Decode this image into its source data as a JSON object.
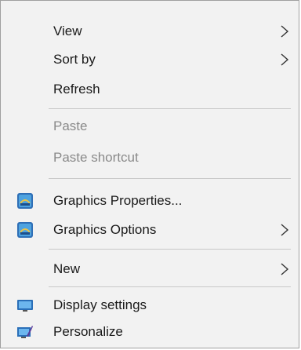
{
  "context_menu": {
    "items": [
      {
        "label": "View",
        "has_submenu": true,
        "enabled": true
      },
      {
        "label": "Sort by",
        "has_submenu": true,
        "enabled": true
      },
      {
        "label": "Refresh",
        "has_submenu": false,
        "enabled": true
      },
      {
        "label": "Paste",
        "has_submenu": false,
        "enabled": false
      },
      {
        "label": "Paste shortcut",
        "has_submenu": false,
        "enabled": false
      },
      {
        "label": "Graphics Properties...",
        "has_submenu": false,
        "enabled": true,
        "icon": "intel-graphics-icon"
      },
      {
        "label": "Graphics Options",
        "has_submenu": true,
        "enabled": true,
        "icon": "intel-graphics-icon"
      },
      {
        "label": "New",
        "has_submenu": true,
        "enabled": true
      },
      {
        "label": "Display settings",
        "has_submenu": false,
        "enabled": true,
        "icon": "display-monitor-icon"
      },
      {
        "label": "Personalize",
        "has_submenu": false,
        "enabled": true,
        "icon": "personalize-icon"
      }
    ]
  },
  "colors": {
    "menu_background": "#f2f2f2",
    "border": "#a0a0a0",
    "text": "#1a1a1a",
    "disabled_text": "#8a8a8a",
    "separator": "#c8c8c8"
  }
}
